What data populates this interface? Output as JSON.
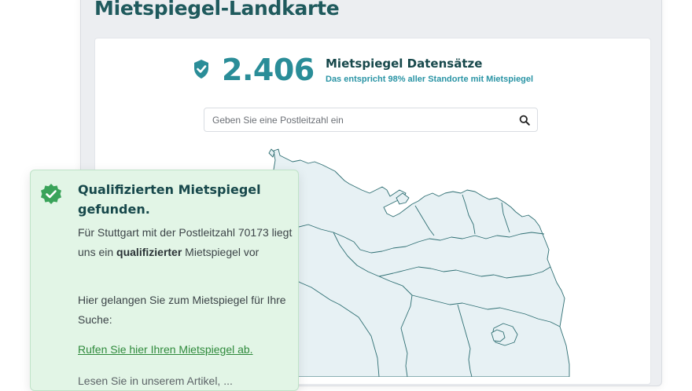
{
  "page": {
    "title": "Mietspiegel-Landkarte"
  },
  "stats": {
    "count": "2.406",
    "label": "Mietspiegel Datensätze",
    "subtitle": "Das entspricht 98% aller Standorte mit Mietspiegel"
  },
  "search": {
    "placeholder": "Geben Sie eine Postleitzahl ein",
    "value": ""
  },
  "result": {
    "title": "Qualifizierten Mietspiegel gefunden.",
    "text_before": "Für Stuttgart mit der Postleitzahl 70173 liegt uns ein ",
    "text_bold": "qualifizierter",
    "text_after": " Mietspiegel vor",
    "instruction": "Hier gelangen Sie zum Mietspiegel für Ihre Suche:",
    "link_label": "Rufen Sie hier Ihren Mietspiegel ab.",
    "more_text": "Lesen Sie in unserem Artikel, ..."
  },
  "icons": {
    "stat": "shield-check-icon",
    "search": "search-icon",
    "result": "verified-badge-icon"
  },
  "colors": {
    "accent": "#2a8d98",
    "title": "#1f5a5d",
    "success_bg": "#e2f5e6",
    "success": "#3aa35a",
    "map_fill": "#e7f1f4",
    "map_stroke": "#2f6f73"
  }
}
